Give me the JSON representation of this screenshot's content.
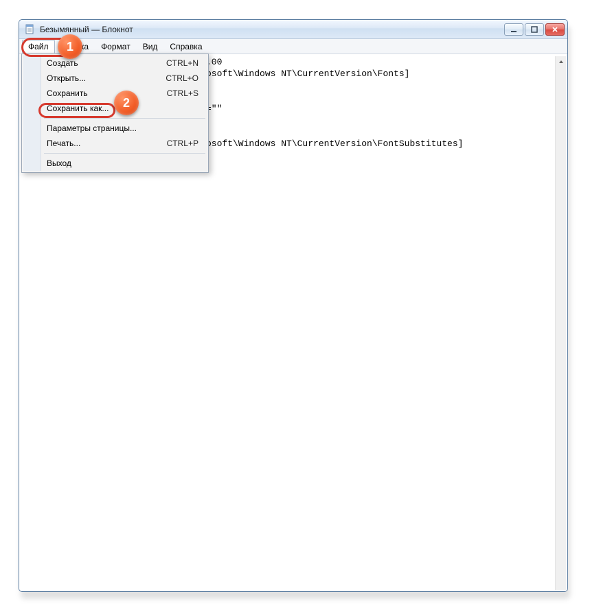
{
  "window": {
    "title": "Безымянный — Блокнот"
  },
  "menubar": {
    "file": "Файл",
    "edit": "Правка",
    "format": "Формат",
    "view": "Вид",
    "help": "Справка"
  },
  "file_menu": {
    "new": {
      "label": "Создать",
      "shortcut": "CTRL+N"
    },
    "open": {
      "label": "Открыть...",
      "shortcut": "CTRL+O"
    },
    "save": {
      "label": "Сохранить",
      "shortcut": "CTRL+S"
    },
    "save_as": {
      "label": "Сохранить как...",
      "shortcut": ""
    },
    "page_setup": {
      "label": "Параметры страницы...",
      "shortcut": ""
    },
    "print": {
      "label": "Печать...",
      "shortcut": "CTRL+P"
    },
    "exit": {
      "label": "Выход",
      "shortcut": ""
    }
  },
  "editor": {
    "line1_tail": ".00",
    "line2_tail": "osoft\\Windows NT\\CurrentVersion\\Fonts]",
    "line3_tail": "=\"\"",
    "line4_tail": "osoft\\Windows NT\\CurrentVersion\\FontSubstitutes]"
  },
  "badges": {
    "b1": "1",
    "b2": "2"
  }
}
